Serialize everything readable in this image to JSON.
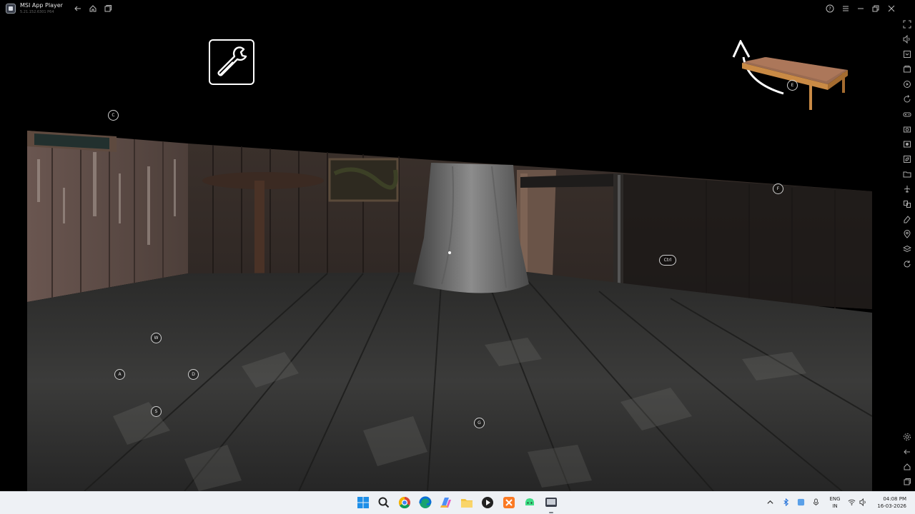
{
  "window": {
    "title": "MSI App Player",
    "version": "5.21.152.6301 P64",
    "left_icons": [
      "back-icon",
      "home-icon",
      "multi-instance-icon"
    ],
    "right_icons": [
      "help-icon",
      "menu-icon",
      "minimize-icon",
      "restore-icon",
      "close-icon"
    ]
  },
  "sidebar": {
    "items": [
      "fullscreen-icon",
      "volume-icon",
      "install-apk-icon",
      "media-folder-icon",
      "macro-icon",
      "rotate-icon",
      "gamepad-icon",
      "screenshot-icon",
      "record-icon",
      "eco-mode-icon",
      "folder-icon",
      "airplane-icon",
      "multi-sync-icon",
      "erase-icon",
      "location-icon",
      "layers-icon",
      "refresh-icon"
    ],
    "bottom_items": [
      "settings-icon",
      "back-icon",
      "home-icon",
      "recents-icon"
    ]
  },
  "hud": {
    "wrench_icon": "wrench-icon",
    "held_item_icon": "bed-icon",
    "key_hints": {
      "c": "C",
      "e": "E",
      "f": "F",
      "ctrl": "Ctrl",
      "w": "W",
      "a": "A",
      "d": "D",
      "s": "S",
      "g": "G"
    }
  },
  "taskbar": {
    "apps": [
      "windows-start-icon",
      "search-icon",
      "chrome-icon",
      "edge-icon",
      "copilot-icon",
      "file-explorer-icon",
      "media-player-icon",
      "xampp-icon",
      "android-icon",
      "msi-app-player-icon"
    ],
    "tray": {
      "language_line1": "ENG",
      "language_line2": "IN",
      "time": "04:08 PM",
      "date": "16-03-2026"
    }
  },
  "colors": {
    "background": "#000000",
    "taskbar": "#eef1f5",
    "floor": "#3a3a38",
    "wall": "#4a3b34"
  }
}
